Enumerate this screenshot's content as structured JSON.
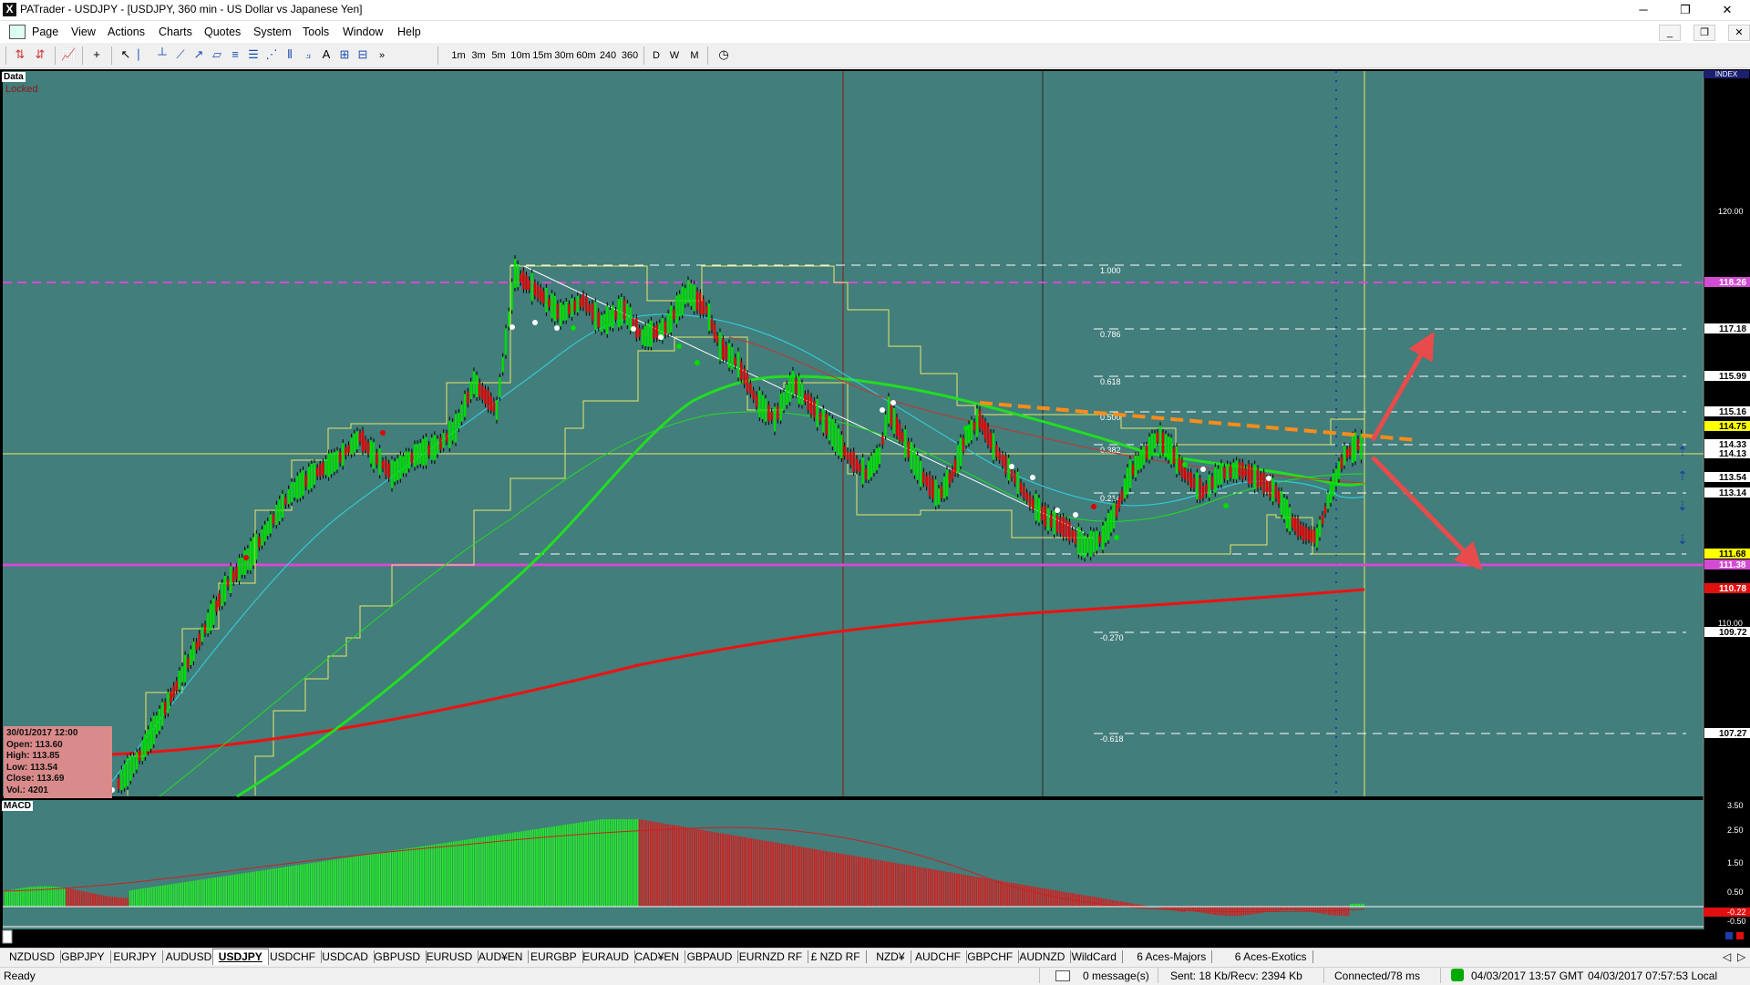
{
  "window": {
    "title": "PATrader - USDJPY - [USDJPY, 360 min - US Dollar vs Japanese Yen]",
    "minimize": "─",
    "maximize": "❐",
    "close": "✕"
  },
  "menu": [
    "Page",
    "View",
    "Actions",
    "Charts",
    "Quotes",
    "System",
    "Tools",
    "Window",
    "Help"
  ],
  "mdi_controls": [
    "_",
    "❐",
    "✕"
  ],
  "toolbar": {
    "timeframes": [
      "1m",
      "3m",
      "5m",
      "10m",
      "15m",
      "30m",
      "60m",
      "240",
      "360"
    ],
    "periods": [
      "D",
      "W",
      "M"
    ],
    "overflow": "»"
  },
  "chart": {
    "data_label": "Data",
    "locked_label": "Locked",
    "index_label": "INDEX",
    "macd_label": "MACD",
    "symbol": "USDJPY",
    "timeframe": "360 min",
    "price_axis_ticks": [
      "120.00",
      "110.00"
    ],
    "price_tags": [
      {
        "label": "118.26",
        "bg": "#d24bd2",
        "fg": "#ffffff"
      },
      {
        "label": "117.18",
        "bg": "#ffffff",
        "fg": "#000000"
      },
      {
        "label": "115.99",
        "bg": "#ffffff",
        "fg": "#000000"
      },
      {
        "label": "115.16",
        "bg": "#ffffff",
        "fg": "#000000"
      },
      {
        "label": "114.75",
        "bg": "#ffff00",
        "fg": "#000000"
      },
      {
        "label": "114.33",
        "bg": "#ffffff",
        "fg": "#000000"
      },
      {
        "label": "114.13",
        "bg": "#ffffff",
        "fg": "#000000"
      },
      {
        "label": "113.54",
        "bg": "#ffffff",
        "fg": "#000000"
      },
      {
        "label": "113.14",
        "bg": "#ffffff",
        "fg": "#000000"
      },
      {
        "label": "111.68",
        "bg": "#ffff00",
        "fg": "#000000"
      },
      {
        "label": "111.38",
        "bg": "#d24bd2",
        "fg": "#ffffff"
      },
      {
        "label": "110.78",
        "bg": "#e01010",
        "fg": "#ffffff"
      },
      {
        "label": "109.72",
        "bg": "#ffffff",
        "fg": "#000000"
      },
      {
        "label": "107.27",
        "bg": "#ffffff",
        "fg": "#000000"
      }
    ],
    "fib_levels": [
      "1.000",
      "0.786",
      "0.618",
      "0.500",
      "0.382",
      "0.214",
      "-0.270",
      "-0.618"
    ],
    "ohlc": {
      "date": "30/01/2017 12:00",
      "open": "Open: 113.60",
      "high": "High: 113.85",
      "low": "Low: 113.54",
      "close": "Close: 113.69",
      "vol": "Vol.: 4201"
    },
    "macd_ticks": [
      "3.50",
      "2.50",
      "1.50",
      "0.50",
      "-0.22",
      "-0.50"
    ],
    "colors": {
      "background": "#427e7b",
      "bull_candle": "#00dd00",
      "bear_candle": "#dd0000",
      "ma_200": "#ee1111",
      "ma_green": "#22dd22",
      "ma_cyan": "#33c8d6",
      "channel": "#e8e86a",
      "magenta_line": "#d24bd2",
      "trend_orange": "#ff8c1a",
      "arrow_red": "#e84b4b"
    }
  },
  "tabs": [
    "NZDUSD",
    "GBPJPY",
    "EURJPY",
    "AUDUSD",
    "USDJPY",
    "USDCHF",
    "USDCAD",
    "GBPUSD",
    "EURUSD",
    "AUD¥EN",
    "EURGBP",
    "EURAUD",
    "CAD¥EN",
    "GBPAUD",
    "EURNZD RF",
    "£ NZD RF",
    "NZD¥",
    "AUDCHF",
    "GBPCHF",
    "AUDNZD",
    "WildCard",
    "6 Aces-Majors",
    "6 Aces-Exotics"
  ],
  "active_tab": "USDJPY",
  "status": {
    "ready": "Ready",
    "messages": "0 message(s)",
    "traffic": "Sent: 18 Kb/Recv: 2394 Kb",
    "connection": "Connected/78 ms",
    "gmt": "04/03/2017 13:57 GMT",
    "local": "04/03/2017 07:57:53 Local"
  }
}
